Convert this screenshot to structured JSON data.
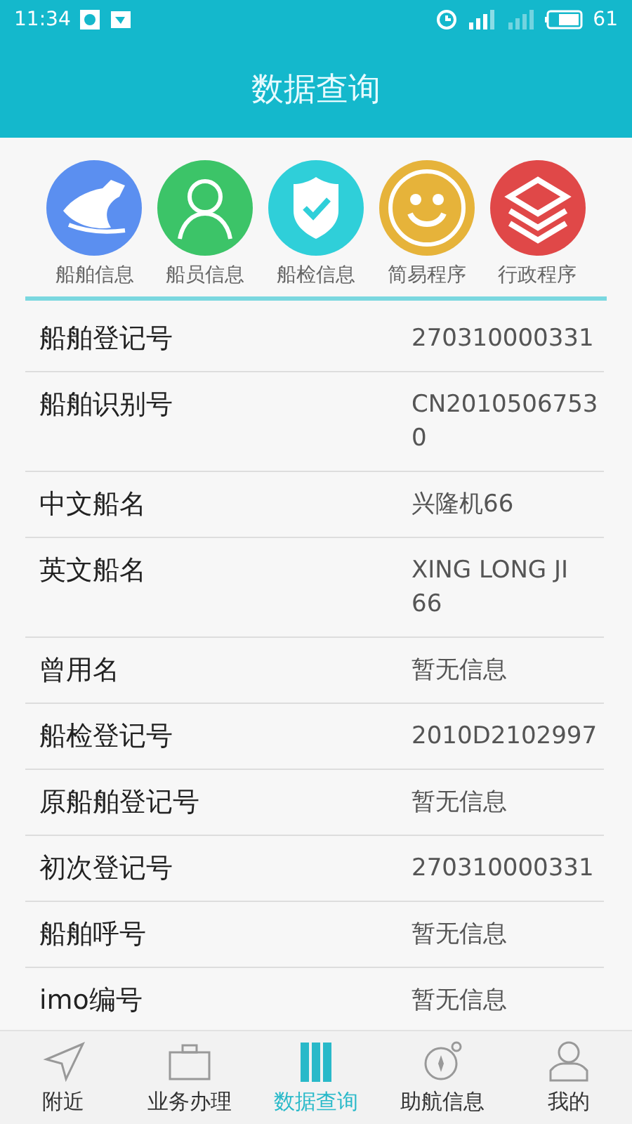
{
  "status_bar": {
    "time": "11:34",
    "battery": "61"
  },
  "header": {
    "title": "数据查询"
  },
  "categories": [
    {
      "kind": "ship",
      "label": "船舶信息",
      "color": "#5b8ff0"
    },
    {
      "kind": "crew",
      "label": "船员信息",
      "color": "#3cc468"
    },
    {
      "kind": "inspection",
      "label": "船检信息",
      "color": "#2fcfd9"
    },
    {
      "kind": "simple",
      "label": "简易程序",
      "color": "#e6b33a"
    },
    {
      "kind": "admin",
      "label": "行政程序",
      "color": "#e04848"
    }
  ],
  "details": [
    {
      "label": "船舶登记号",
      "value": "270310000331"
    },
    {
      "label": "船舶识别号",
      "value": "CN20105067530"
    },
    {
      "label": "中文船名",
      "value": "兴隆机66"
    },
    {
      "label": "英文船名",
      "value": "XING LONG JI 66"
    },
    {
      "label": "曾用名",
      "value": "暂无信息"
    },
    {
      "label": "船检登记号",
      "value": "2010D2102997"
    },
    {
      "label": "原船舶登记号",
      "value": "暂无信息"
    },
    {
      "label": "初次登记号",
      "value": "270310000331"
    },
    {
      "label": "船舶呼号",
      "value": "暂无信息"
    },
    {
      "label": "imo编号",
      "value": "暂无信息"
    }
  ],
  "bottom_nav": [
    {
      "kind": "nearby",
      "label": "附近",
      "selected": false
    },
    {
      "kind": "business",
      "label": "业务办理",
      "selected": false
    },
    {
      "kind": "data",
      "label": "数据查询",
      "selected": true
    },
    {
      "kind": "navigation",
      "label": "助航信息",
      "selected": false
    },
    {
      "kind": "me",
      "label": "我的",
      "selected": false
    }
  ]
}
